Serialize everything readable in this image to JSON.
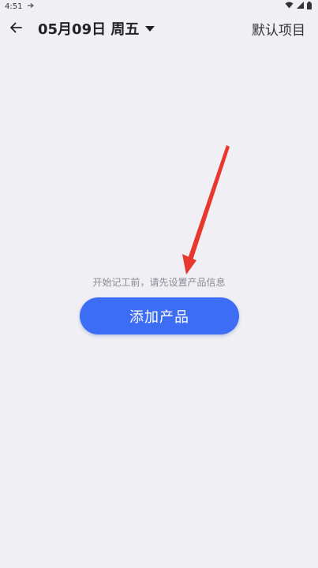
{
  "status_bar": {
    "time": "4:51",
    "notification_icon": "dnd-icon",
    "icons": [
      "wifi-icon",
      "signal-icon",
      "battery-icon"
    ]
  },
  "header": {
    "back_icon": "arrow-left-icon",
    "date_label": "05月09日 周五",
    "dropdown_icon": "caret-down-icon",
    "project_label": "默认项目"
  },
  "main": {
    "hint": "开始记工前，请先设置产品信息",
    "add_button_label": "添加产品"
  },
  "colors": {
    "background": "#efeff4",
    "accent": "#3d6df5",
    "annotation_arrow": "#e8372e"
  }
}
